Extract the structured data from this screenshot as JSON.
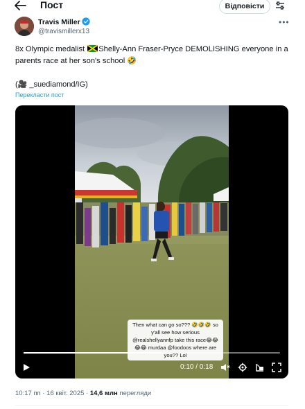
{
  "topbar": {
    "title": "Пост",
    "reply_label": "Відповісти"
  },
  "author": {
    "name": "Travis Miller",
    "handle": "@travismillerx13"
  },
  "post": {
    "text_before_flag": "8x Olympic medalist ",
    "text_after_flag": "Shelly-Ann Fraser-Pryce DEMOLISHING everyone in a parents race at her son's school 🤣",
    "credit": "(🎥 _suediamond/IG)",
    "translate_label": "Перекласти пост"
  },
  "video": {
    "caption": "Then what can go so??? 🤣🤣🤣 so y'all see how serious @realshellyannfp take this race😂😂😂😂 murdaa @foodoos where are you?? Lol",
    "current_time": "0:10",
    "duration": "0:18",
    "time_display": "0:10 / 0:18",
    "progress": 0.556
  },
  "meta": {
    "time": "10:17 пп",
    "separator": "·",
    "date": "16 квіт. 2025",
    "views": "14,6 млн",
    "views_label": "перегляди"
  },
  "icons": [
    "back-arrow-icon",
    "filter-icon",
    "verified-badge-icon",
    "more-icon",
    "jamaica-flag-icon",
    "play-icon",
    "volume-icon",
    "settings-icon",
    "pip-icon",
    "fullscreen-icon"
  ],
  "colors": {
    "link": "#1d9bf0",
    "verified": "#1d9bf0",
    "secondary_text": "#536471"
  }
}
